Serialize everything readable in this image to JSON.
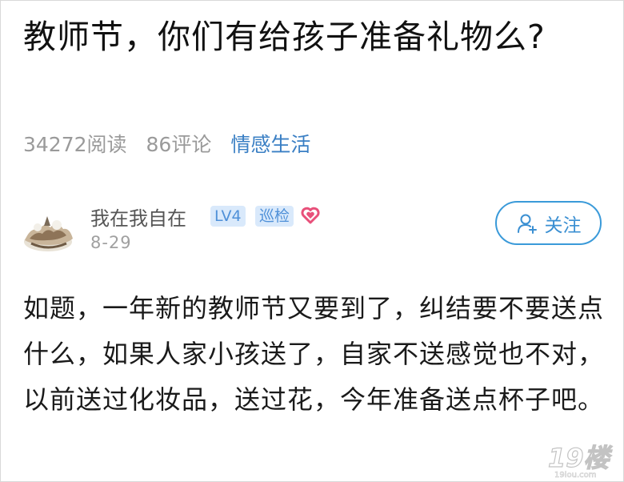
{
  "post": {
    "title": "教师节，你们有给孩子准备礼物么?",
    "reads": "34272阅读",
    "comments": "86评论",
    "category": "情感生活",
    "body": "如题，一年新的教师节又要到了，纠结要不要送点什么，如果人家小孩送了，自家不送感觉也不对，以前送过化妆品，送过花，今年准备送点杯子吧。"
  },
  "author": {
    "name": "我在我自在",
    "level_badge": "LV4",
    "role_badge": "巡检",
    "date": "8-29",
    "avatar_icon": "avatar-image",
    "heart_icon": "heart-icon"
  },
  "actions": {
    "follow_label": "关注",
    "follow_icon": "user-plus-icon"
  },
  "watermark": {
    "text": "19楼",
    "subtext": "19lou.com"
  },
  "colors": {
    "accent": "#3a8fd2",
    "category": "#3a7fc4",
    "badge_bg": "#d9e9fb",
    "heart": "#e8507a",
    "muted": "#9a9a9a"
  }
}
